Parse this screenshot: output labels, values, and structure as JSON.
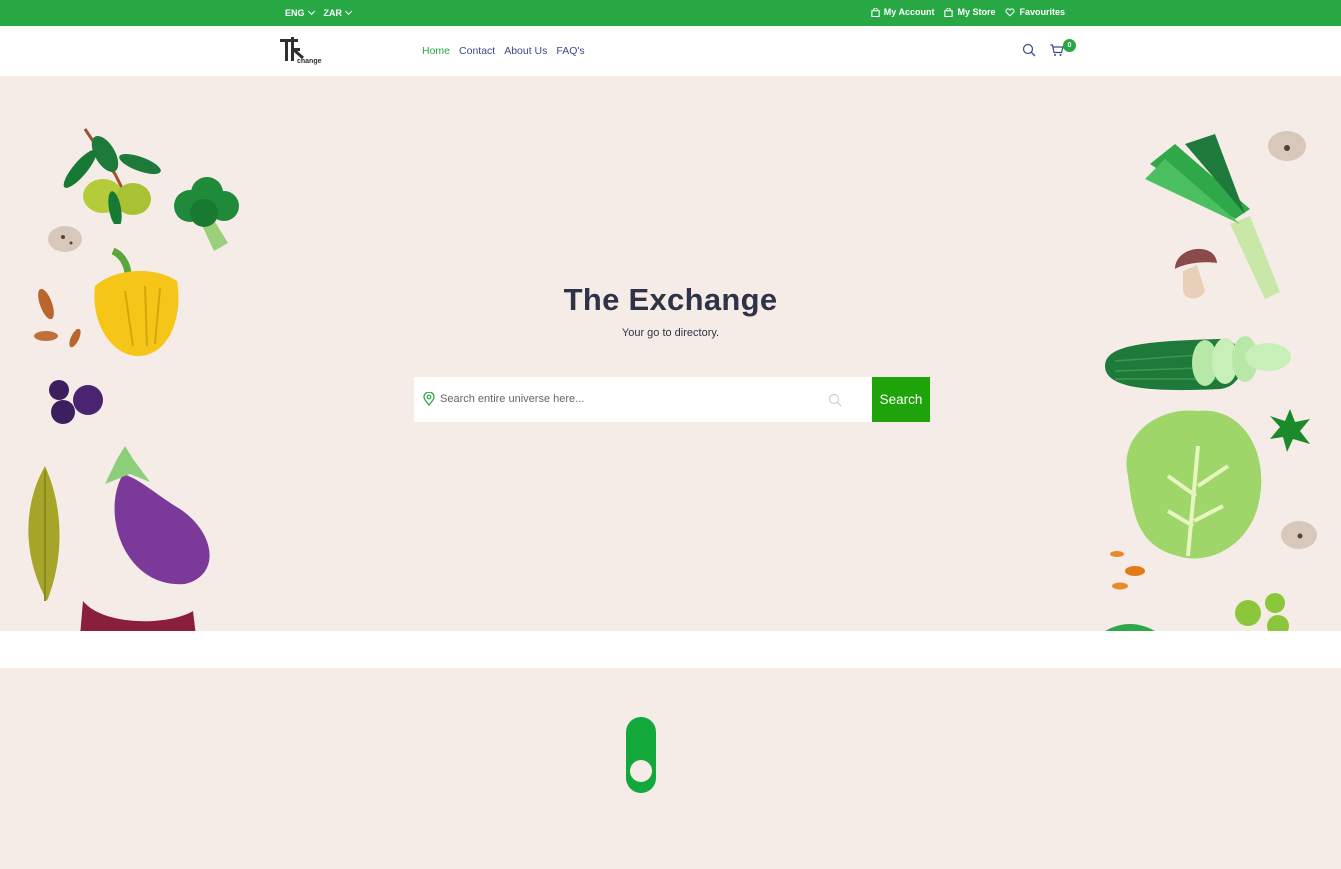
{
  "topbar": {
    "language": "ENG",
    "currency": "ZAR",
    "my_account": "My Account",
    "my_store": "My Store",
    "favourites": "Favourites"
  },
  "nav": {
    "items": [
      {
        "label": "Home",
        "active": true
      },
      {
        "label": "Contact",
        "active": false
      },
      {
        "label": "About Us",
        "active": false
      },
      {
        "label": "FAQ's",
        "active": false
      }
    ],
    "cart_count": "0"
  },
  "logo": {
    "text": "change"
  },
  "hero": {
    "title": "The Exchange",
    "subtitle": "Your go to directory.",
    "search_placeholder": "Search entire universe here...",
    "search_button": "Search"
  },
  "colors": {
    "brand_green": "#28a745",
    "button_green": "#1fa30a",
    "hero_bg": "#f6ece7",
    "nav_text": "#3b4a8a",
    "title_text": "#2f3347"
  },
  "icons": [
    "chevron-down-icon",
    "bag-icon",
    "heart-icon",
    "search-icon",
    "cart-icon",
    "location-pin-icon",
    "magnifier-icon"
  ]
}
